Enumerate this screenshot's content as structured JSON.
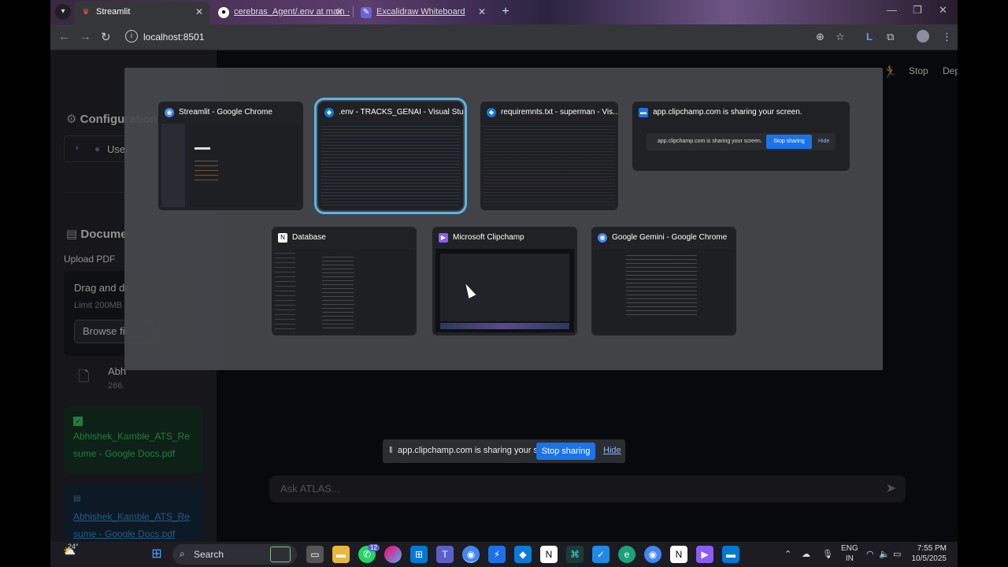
{
  "browser": {
    "tabs": [
      {
        "title": "Streamlit",
        "icon": "streamlit-icon"
      },
      {
        "title": "cerebras_Agent/.env at main · a",
        "icon": "github-icon"
      },
      {
        "title": "Excalidraw Whiteboard",
        "icon": "excalidraw-icon"
      }
    ],
    "url": "localhost:8501",
    "toolbar_icons": [
      "zoom-icon",
      "star-icon",
      "extension-L-icon",
      "extensions-icon",
      "profile-avatar",
      "menu-icon"
    ]
  },
  "app": {
    "header": {
      "stop_label": "Stop",
      "deploy_label": "Deploy"
    },
    "sidebar": {
      "configuration_title": "Configuration",
      "user_expander_label": "User",
      "documents_title": "Docume",
      "upload_label": "Upload PDF",
      "uploader_text": "Drag and dr",
      "uploader_limit": "Limit 200MB",
      "browse_label": "Browse fil",
      "file_name": "Abh",
      "file_size": "266.",
      "success_message": "Abhishek_Kamble_ATS_Resume - Google Docs.pdf",
      "info_message": "Abhishek_Kamble_ATS_Resume - Google Docs.pdf"
    },
    "chat_placeholder": "Ask ATLAS..."
  },
  "picker": {
    "windows": [
      {
        "title": "Streamlit - Google Chrome",
        "icon": "chrome-icon",
        "selected": false
      },
      {
        "title": ".env - TRACKS_GENAI - Visual Studi...",
        "icon": "vscode-icon",
        "selected": true
      },
      {
        "title": "requiremnts.txt - superman - Vis...",
        "icon": "vscode-icon",
        "selected": false
      },
      {
        "title": "app.clipchamp.com is sharing your screen.",
        "icon": "clipchamp-bar-icon",
        "selected": false
      },
      {
        "title": "Database",
        "icon": "notion-icon",
        "selected": false
      },
      {
        "title": "Microsoft Clipchamp",
        "icon": "clipchamp-icon",
        "selected": false
      },
      {
        "title": "Google Gemini - Google Chrome",
        "icon": "chrome-icon",
        "selected": false
      }
    ],
    "preview_share_text": "app.clipchamp.com is sharing your screen.",
    "preview_stop_label": "Stop sharing",
    "preview_hide_label": "Hide"
  },
  "sharing_bar": {
    "text": "app.clipchamp.com is sharing your screen.",
    "stop_label": "Stop sharing",
    "hide_label": "Hide"
  },
  "taskbar": {
    "weather": "24°",
    "search_label": "Search",
    "notification_badge": "12",
    "language": "ENG",
    "region": "IN",
    "time": "7:55 PM",
    "date": "10/5/2025"
  },
  "colors": {
    "accent_blue": "#1a73e8",
    "selected_outline": "#5ab4e8",
    "success_green": "#3dd56d",
    "info_blue": "#3f9cde"
  }
}
